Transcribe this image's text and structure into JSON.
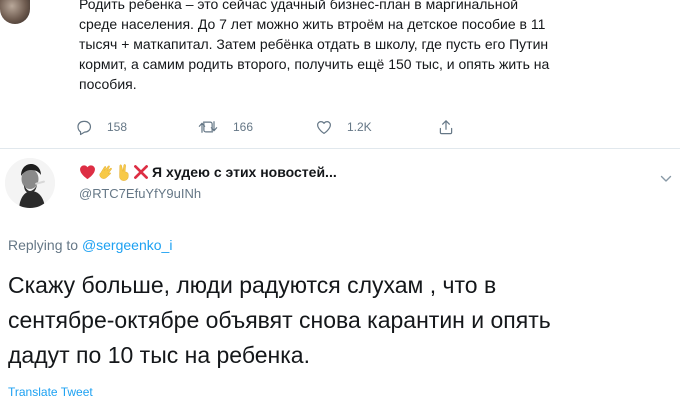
{
  "original_tweet": {
    "text": "Родить ребенка – это сейчас удачный бизнес-план в маргинальной\nсреде населения. До 7 лет можно жить втроём на детское пособие в 11\nтысяч + маткапитал. Затем ребёнка отдать в школу, где пусть его Путин\nкормит, а самим родить второго, получить ещё 150 тыс, и опять жить на\nпособия.",
    "actions": {
      "reply_count": "158",
      "retweet_count": "166",
      "like_count": "1.2K"
    }
  },
  "reply_tweet": {
    "display_name": "Я худею с этих новостей...",
    "name_emojis": [
      "heart-emoji",
      "clap-emoji",
      "victory-hand-emoji",
      "cross-mark-emoji"
    ],
    "handle": "@RTC7EfuYfY9uINh",
    "replying_to_prefix": "Replying to",
    "replying_to_handle": "@sergeenko_i",
    "text": "Скажу больше, люди радуются слухам , что в\nсентябре-октябре объявят снова карантин и опять\nдадут по 10 тыс на ребенка.",
    "translate_label": "Translate Tweet"
  },
  "colors": {
    "primary_text": "#14171a",
    "secondary_text": "#657786",
    "link": "#1da1f2",
    "divider": "#e1e8ed"
  }
}
